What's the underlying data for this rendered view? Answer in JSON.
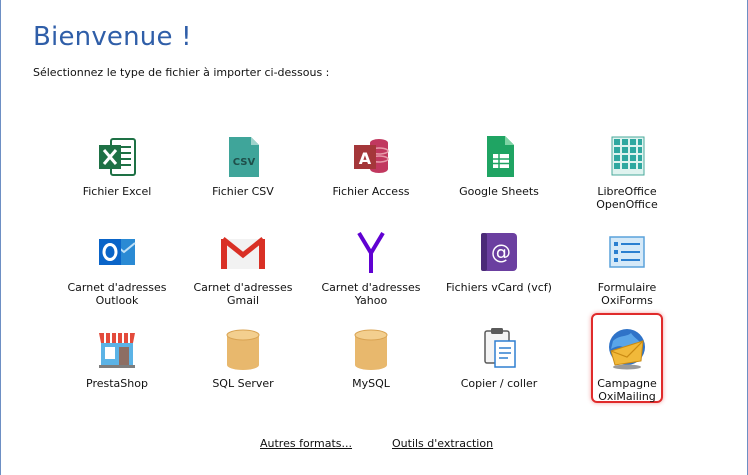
{
  "header": {
    "title": "Bienvenue !",
    "subtitle": "Sélectionnez le type de fichier à importer ci-dessous :"
  },
  "tiles": [
    {
      "label": "Fichier Excel",
      "icon": "excel-icon"
    },
    {
      "label": "Fichier CSV",
      "icon": "csv-file-icon"
    },
    {
      "label": "Fichier Access",
      "icon": "access-icon"
    },
    {
      "label": "Google Sheets",
      "icon": "google-sheets-icon"
    },
    {
      "label": "LibreOffice\nOpenOffice",
      "icon": "libreoffice-calc-icon"
    },
    {
      "label": "Carnet d'adresses\nOutlook",
      "icon": "outlook-icon"
    },
    {
      "label": "Carnet d'adresses\nGmail",
      "icon": "gmail-icon"
    },
    {
      "label": "Carnet d'adresses\nYahoo",
      "icon": "yahoo-icon"
    },
    {
      "label": "Fichiers vCard (vcf)",
      "icon": "vcard-icon"
    },
    {
      "label": "Formulaire\nOxiForms",
      "icon": "oxiforms-icon"
    },
    {
      "label": "PrestaShop",
      "icon": "prestashop-store-icon"
    },
    {
      "label": "SQL Server",
      "icon": "database-icon"
    },
    {
      "label": "MySQL",
      "icon": "database-icon"
    },
    {
      "label": "Copier / coller",
      "icon": "clipboard-icon"
    },
    {
      "label": "Campagne\nOxiMailing",
      "icon": "oximailing-globe-icon",
      "selected": true
    }
  ],
  "links": {
    "more_formats": "Autres formats...",
    "extraction_tools": "Outils d'extraction"
  },
  "colors": {
    "title": "#2f5ea8",
    "selection_border": "#e02b2b",
    "excel": "#1e7145",
    "csv": "#3fa59a",
    "access": "#a4373a",
    "sheets": "#1fa463",
    "outlook": "#0a64c8",
    "gmail": "#d93025",
    "yahoo": "#6001d2",
    "vcard": "#6b3fa0",
    "database": "#e8b86d"
  }
}
